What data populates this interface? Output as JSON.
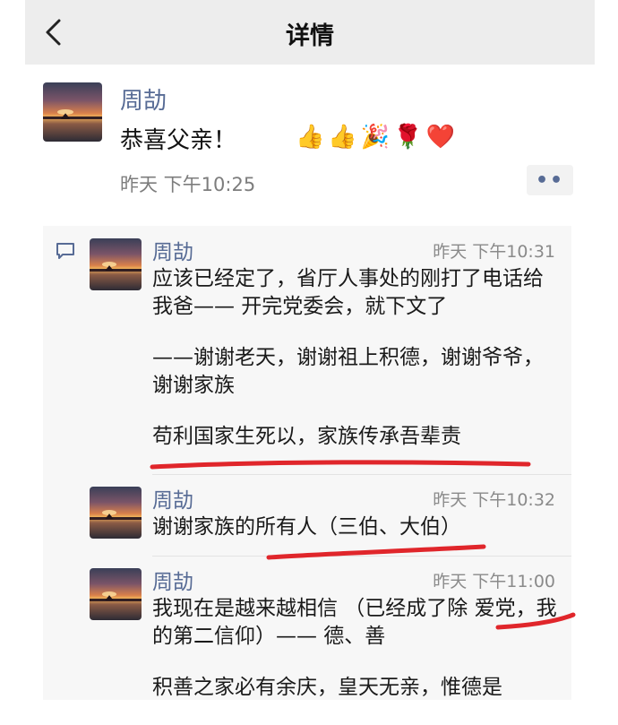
{
  "header": {
    "title": "详情",
    "back_icon": "chevron-left-icon"
  },
  "post": {
    "author": "周劼",
    "text": "恭喜父亲！",
    "emojis": [
      "👍",
      "👍",
      "🎉",
      "🌹",
      "❤️"
    ],
    "time": "昨天 下午10:25",
    "more_label": "••"
  },
  "comments": [
    {
      "author": "周劼",
      "time": "昨天 下午10:31",
      "paragraphs": [
        "应该已经定了，省厅人事处的刚打了电话给我爸—— 开完党委会，就下文了",
        "——谢谢老天，谢谢祖上积德，谢谢爷爷，谢谢家族",
        "苟利国家生死以，家族传承吾辈责"
      ]
    },
    {
      "author": "周劼",
      "time": "昨天 下午10:32",
      "paragraphs": [
        "谢谢家族的所有人（三伯、大伯）"
      ]
    },
    {
      "author": "周劼",
      "time": "昨天 下午11:00",
      "paragraphs": [
        "我现在是越来越相信 （已经成了除 爱党，我的第二信仰）—— 德、善",
        "积善之家必有余庆，皇天无亲，惟德是"
      ]
    }
  ],
  "colors": {
    "name": "#576b95",
    "annotation": "#e0262b",
    "header_bg": "#ededed",
    "comments_bg": "#f7f7f7"
  }
}
